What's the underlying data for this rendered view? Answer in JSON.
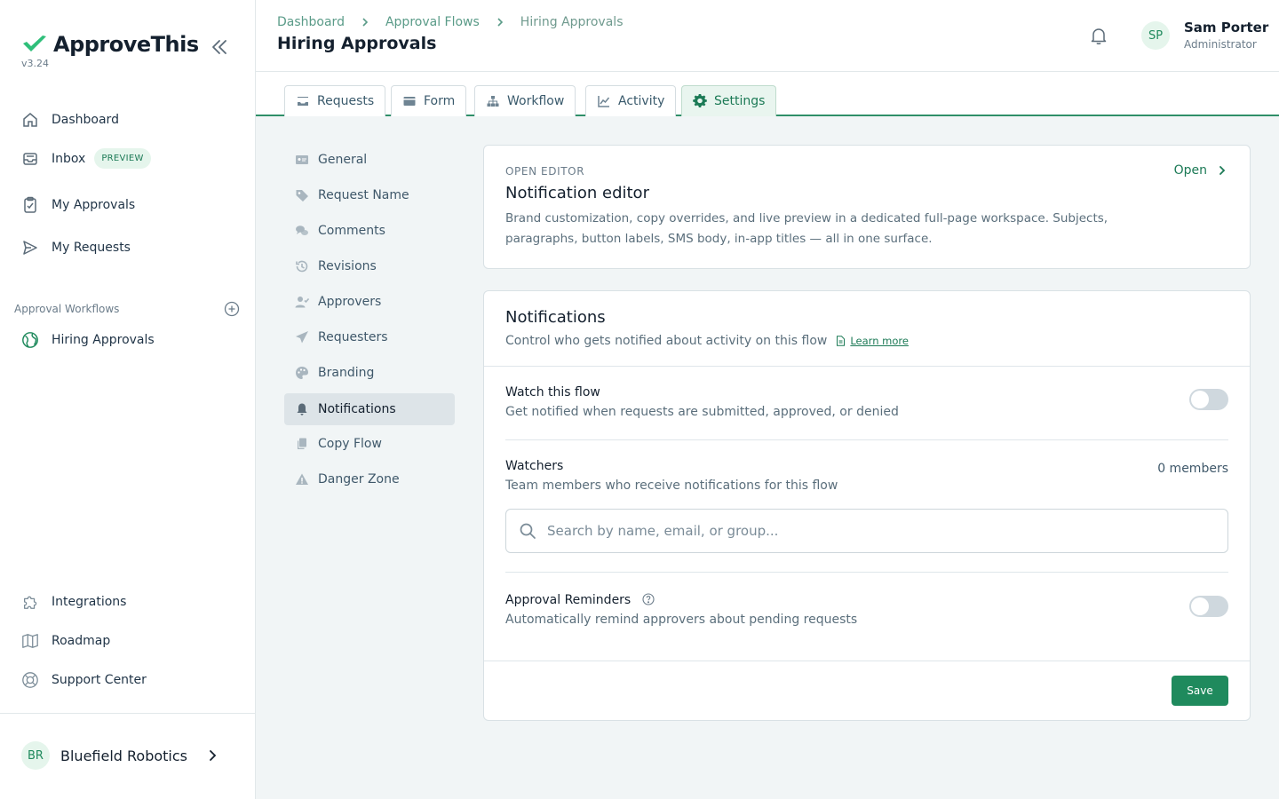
{
  "brand": {
    "name": "ApproveThis",
    "version": "v3.24",
    "accent": "#1f8a5d"
  },
  "sidebar": {
    "items": [
      {
        "label": "Dashboard",
        "icon": "home-icon"
      },
      {
        "label": "Inbox",
        "badge": "PREVIEW",
        "icon": "inbox-icon"
      },
      {
        "label": "My Approvals",
        "icon": "clipboard-check-icon"
      },
      {
        "label": "My Requests",
        "icon": "send-icon"
      }
    ],
    "section_label": "Approval Workflows",
    "workflows": [
      {
        "label": "Hiring Approvals",
        "icon": "globe-icon"
      }
    ],
    "footer_items": [
      {
        "label": "Integrations",
        "icon": "puzzle-icon"
      },
      {
        "label": "Roadmap",
        "icon": "map-icon"
      },
      {
        "label": "Support Center",
        "icon": "lifebuoy-icon"
      }
    ],
    "org": {
      "initials": "BR",
      "name": "Bluefield Robotics"
    }
  },
  "header": {
    "breadcrumbs": [
      "Dashboard",
      "Approval Flows",
      "Hiring Approvals"
    ],
    "title": "Hiring Approvals",
    "user": {
      "initials": "SP",
      "name": "Sam Porter",
      "role": "Administrator"
    }
  },
  "tabs": [
    {
      "label": "Requests",
      "icon": "inbox-tray-icon"
    },
    {
      "label": "Form",
      "icon": "form-icon"
    },
    {
      "label": "Workflow",
      "icon": "sitemap-icon"
    },
    {
      "label": "Activity",
      "icon": "chart-line-icon"
    },
    {
      "label": "Settings",
      "icon": "gear-icon",
      "active": true
    }
  ],
  "settings_nav": [
    {
      "label": "General",
      "icon": "id-card-icon"
    },
    {
      "label": "Request Name",
      "icon": "tag-icon"
    },
    {
      "label": "Comments",
      "icon": "comments-icon"
    },
    {
      "label": "Revisions",
      "icon": "history-icon"
    },
    {
      "label": "Approvers",
      "icon": "user-check-icon"
    },
    {
      "label": "Requesters",
      "icon": "paper-plane-icon"
    },
    {
      "label": "Branding",
      "icon": "palette-icon"
    },
    {
      "label": "Notifications",
      "icon": "bell-icon",
      "active": true
    },
    {
      "label": "Copy Flow",
      "icon": "copy-icon"
    },
    {
      "label": "Danger Zone",
      "icon": "warning-icon"
    }
  ],
  "editor_card": {
    "overline": "OPEN EDITOR",
    "title": "Notification editor",
    "description": "Brand customization, copy overrides, and live preview in a dedicated full-page workspace. Subjects, paragraphs, button labels, SMS body, in-app titles — all in one surface.",
    "link": "Open"
  },
  "notifications": {
    "title": "Notifications",
    "subtitle": "Control who gets notified about activity on this flow",
    "learn_more": "Learn more",
    "watch": {
      "title": "Watch this flow",
      "desc": "Get notified when requests are submitted, approved, or denied",
      "enabled": false
    },
    "watchers": {
      "title": "Watchers",
      "desc": "Team members who receive notifications for this flow",
      "count": "0 members",
      "search_placeholder": "Search by name, email, or group..."
    },
    "reminders": {
      "title": "Approval Reminders",
      "desc": "Automatically remind approvers about pending requests",
      "enabled": false
    },
    "save_label": "Save"
  }
}
